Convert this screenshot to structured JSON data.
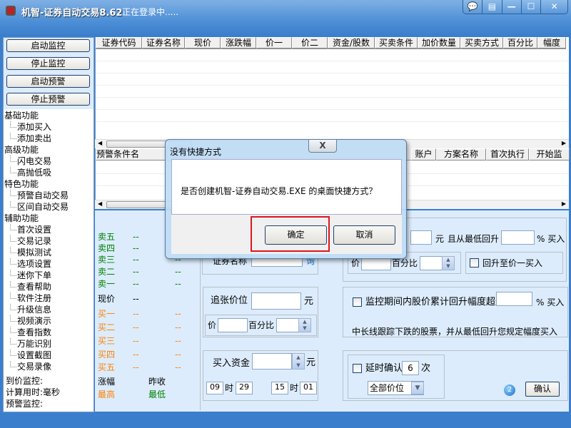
{
  "window": {
    "title": "机智-证券自动交易8.62",
    "status": "正在登录中.....",
    "controls": [
      "💬",
      "▤",
      "—",
      "☐",
      "✕"
    ]
  },
  "left": {
    "buttons": [
      "启动监控",
      "停止监控",
      "启动预警",
      "停止预警"
    ],
    "tree": [
      {
        "label": "基础功能",
        "children": [
          "添加买入",
          "添加卖出"
        ]
      },
      {
        "label": "高级功能",
        "children": [
          "闪电交易",
          "高抛低吸"
        ]
      },
      {
        "label": "特色功能",
        "children": [
          "预警自动交易",
          "区间自动交易"
        ]
      },
      {
        "label": "辅助功能",
        "children": [
          "首次设置",
          "交易记录",
          "模拟测试",
          "选项设置",
          "迷你下单",
          "查看帮助",
          "软件注册",
          "升级信息",
          "视频演示",
          "查看指数",
          "万能识别",
          "设置截图",
          "交易录像"
        ]
      }
    ],
    "status": [
      "到价监控:",
      "计算用时:毫秒",
      "预警监控:"
    ]
  },
  "grid1": {
    "columns": [
      "证券代码",
      "证券名称",
      "现价",
      "涨跌幅",
      "价一",
      "价二",
      "资金/股数",
      "买卖条件",
      "加价数量",
      "买卖方式",
      "百分比",
      "幅度"
    ]
  },
  "grid2": {
    "columns": [
      "预警条件名",
      "账户",
      "方案名称",
      "首次执行",
      "开始监"
    ]
  },
  "quotes": {
    "sell": [
      {
        "label": "卖五",
        "a": "--"
      },
      {
        "label": "卖四",
        "a": "--"
      },
      {
        "label": "卖三",
        "a": "--",
        "b": "--"
      },
      {
        "label": "卖二",
        "a": "--",
        "b": "--"
      },
      {
        "label": "卖一",
        "a": "--",
        "b": "--"
      }
    ],
    "current": {
      "label": "现价",
      "a": "--"
    },
    "buy": [
      {
        "label": "买一",
        "a": "--",
        "b": "--"
      },
      {
        "label": "买二",
        "a": "--",
        "b": "--"
      },
      {
        "label": "买三",
        "a": "--",
        "b": "--"
      },
      {
        "label": "买四",
        "a": "--",
        "b": "--"
      },
      {
        "label": "买五",
        "a": "--",
        "b": "--"
      }
    ],
    "change_label": "涨幅",
    "prev_close_label": "昨收",
    "high_label": "最高",
    "low_label": "最低",
    "colors": {
      "sell": "#008000",
      "buy": "#ff8000"
    }
  },
  "form": {
    "stock_name_label": "证券名称",
    "query_link": "询",
    "chase_label": "追张价位",
    "yuan": "元",
    "price_label": "价",
    "percent_label": "百分比",
    "fund_label": "买入资金",
    "start_hour": "09",
    "start_min": "29",
    "end_hour": "15",
    "end_min": "01",
    "hour_unit": "时",
    "rebound_from_low_label": "且从最低回升",
    "pct_buy": "% 买入",
    "rebound_to_price1": "回升至价一买入",
    "cumulative_label": "监控期间内股价累计回升幅度超过",
    "long_term_desc": "中长线跟踪下跌的股票，并从最低回升您规定幅度买入",
    "delay_label": "延时确认",
    "delay_count": "6",
    "times_unit": "次",
    "price_select": "全部价位",
    "help_badge": "2",
    "confirm": "确认"
  },
  "dialog": {
    "title": "没有快捷方式",
    "message": "是否创建机智-证券自动交易.EXE 的桌面快捷方式？",
    "ok": "确定",
    "cancel": "取消",
    "close": "X"
  }
}
